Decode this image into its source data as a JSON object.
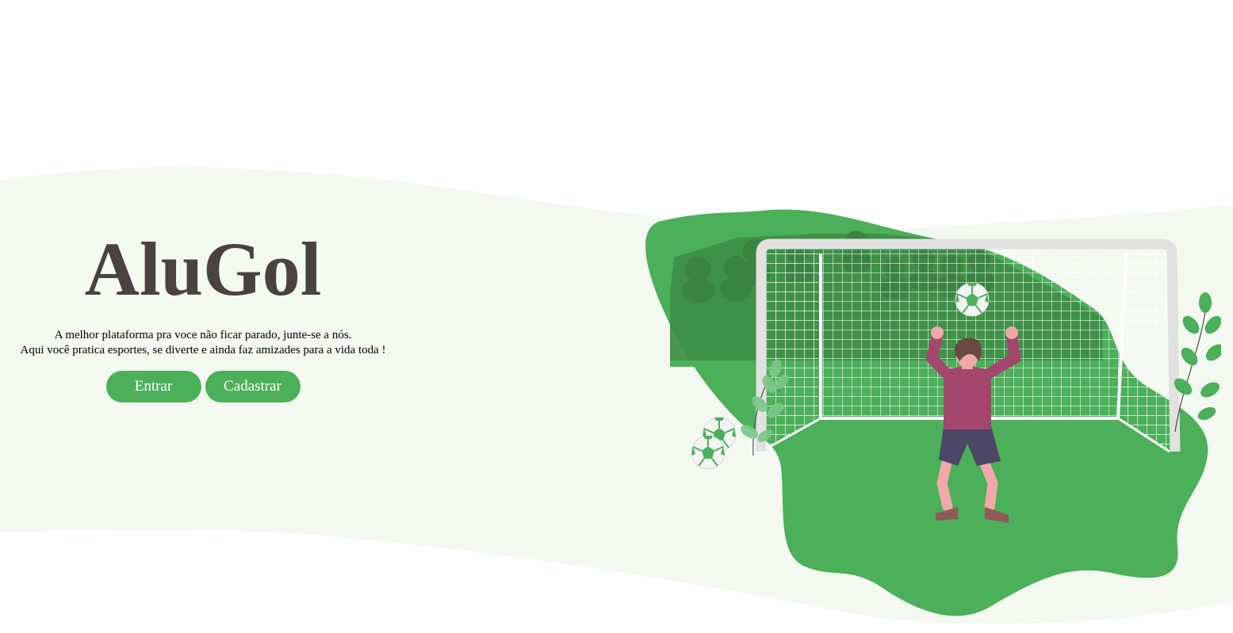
{
  "brand": {
    "title": "AluGol"
  },
  "hero": {
    "tagline_line1": "A melhor plataforma pra voce não ficar parado, junte-se a nós.",
    "tagline_line2": "Aqui você pratica esportes, se diverte e ainda faz amizades para a vida toda !"
  },
  "actions": {
    "login_label": "Entrar",
    "signup_label": "Cadastrar"
  },
  "illustration": {
    "icon": "goalkeeper-soccer-illustration"
  },
  "colors": {
    "accent": "#4caf5a",
    "title": "#4a4242",
    "wave_bg": "#f3f8f1",
    "blob_dark": "#3f8f48",
    "jersey": "#a5466f",
    "shorts": "#4c4766"
  }
}
